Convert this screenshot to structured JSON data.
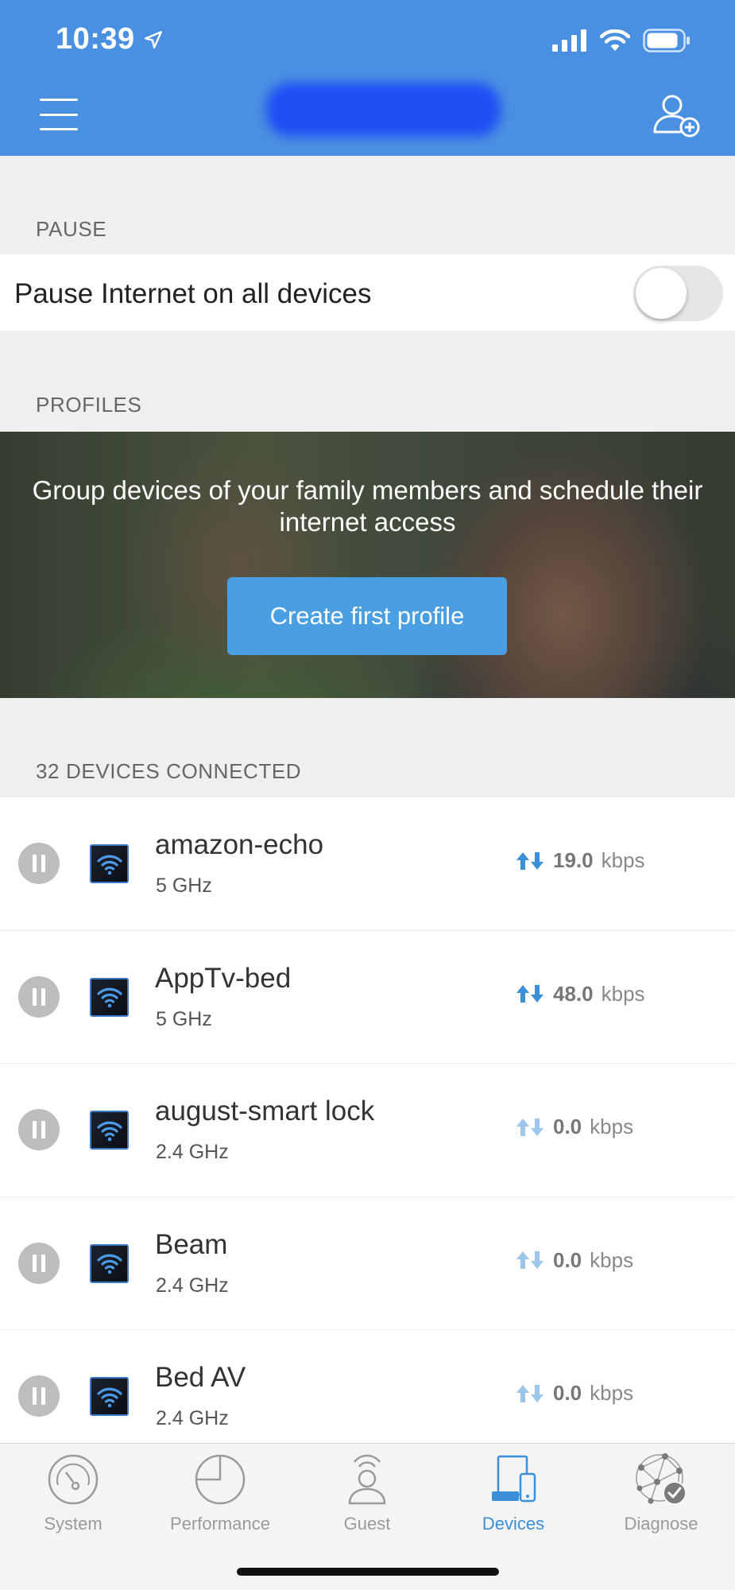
{
  "status_bar": {
    "time": "10:39"
  },
  "header": {
    "title_redacted": true
  },
  "pause": {
    "section_label": "PAUSE",
    "row_label": "Pause Internet on all devices",
    "toggle_on": false
  },
  "profiles": {
    "section_label": "PROFILES",
    "banner_text": "Group devices of your family members and schedule their internet access",
    "button_label": "Create first profile"
  },
  "devices": {
    "section_label": "32 DEVICES CONNECTED",
    "items": [
      {
        "name": "amazon-echo",
        "band": "5 GHz",
        "speed": "19.0",
        "unit": "kbps",
        "active": true
      },
      {
        "name": "AppTv-bed",
        "band": "5 GHz",
        "speed": "48.0",
        "unit": "kbps",
        "active": true
      },
      {
        "name": "august-smart lock",
        "band": "2.4 GHz",
        "speed": "0.0",
        "unit": "kbps",
        "active": false
      },
      {
        "name": "Beam",
        "band": "2.4 GHz",
        "speed": "0.0",
        "unit": "kbps",
        "active": false
      },
      {
        "name": "Bed AV",
        "band": "2.4 GHz",
        "speed": "0.0",
        "unit": "kbps",
        "active": false
      }
    ]
  },
  "tabs": [
    {
      "label": "System",
      "icon": "speedometer-icon",
      "active": false
    },
    {
      "label": "Performance",
      "icon": "pie-chart-icon",
      "active": false
    },
    {
      "label": "Guest",
      "icon": "guest-user-icon",
      "active": false
    },
    {
      "label": "Devices",
      "icon": "devices-icon",
      "active": true
    },
    {
      "label": "Diagnose",
      "icon": "network-check-icon",
      "active": false
    }
  ],
  "colors": {
    "header_blue": "#4a90e2",
    "accent_blue": "#3b8ed8",
    "button_blue": "#4a9ee2",
    "speed_active_arrows": "#3b8ed8",
    "speed_idle_arrows": "#9cc6ec"
  }
}
